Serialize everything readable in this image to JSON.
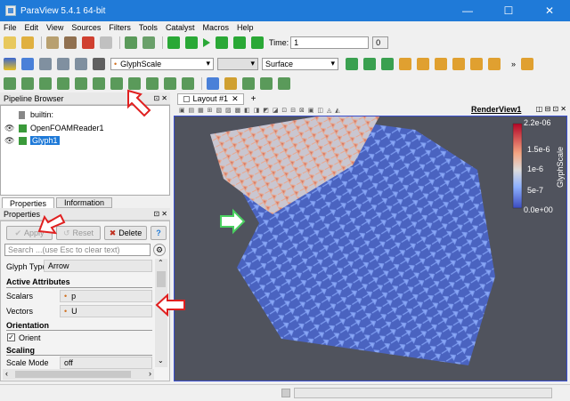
{
  "window": {
    "title": "ParaView 5.4.1 64-bit",
    "minimize": "—",
    "maximize": "☐",
    "close": "✕"
  },
  "menu": [
    "File",
    "Edit",
    "View",
    "Sources",
    "Filters",
    "Tools",
    "Catalyst",
    "Macros",
    "Help"
  ],
  "toolbar": {
    "time_label": "Time:",
    "time_value": "1",
    "time_index": "0"
  },
  "toolbar2": {
    "color_by": "GlyphScale",
    "component": "",
    "representation": "Surface"
  },
  "pipeline": {
    "title": "Pipeline Browser",
    "items": [
      "builtin:",
      "OpenFOAMReader1",
      "Glyph1"
    ]
  },
  "tabs": {
    "properties": "Properties",
    "information": "Information"
  },
  "properties": {
    "title": "Properties",
    "apply": "Apply",
    "reset": "Reset",
    "delete": "Delete",
    "help": "?",
    "search_placeholder": "Search ...(use Esc to clear text)",
    "glyph_type_label": "Glyph Type",
    "glyph_type_value": "Arrow",
    "active_attributes": "Active Attributes",
    "scalars_label": "Scalars",
    "scalars_value": "p",
    "vectors_label": "Vectors",
    "vectors_value": "U",
    "orientation": "Orientation",
    "orient_label": "Orient",
    "scaling": "Scaling",
    "scale_mode_label": "Scale Mode",
    "scale_mode_value": "off"
  },
  "view": {
    "layout_tab": "Layout #1",
    "add_tab": "+",
    "render_view": "RenderView1"
  },
  "colorbar": {
    "title": "GlyphScale",
    "labels": [
      "2.2e-06",
      "1.5e-6",
      "1e-6",
      "5e-7",
      "0.0e+00"
    ]
  }
}
